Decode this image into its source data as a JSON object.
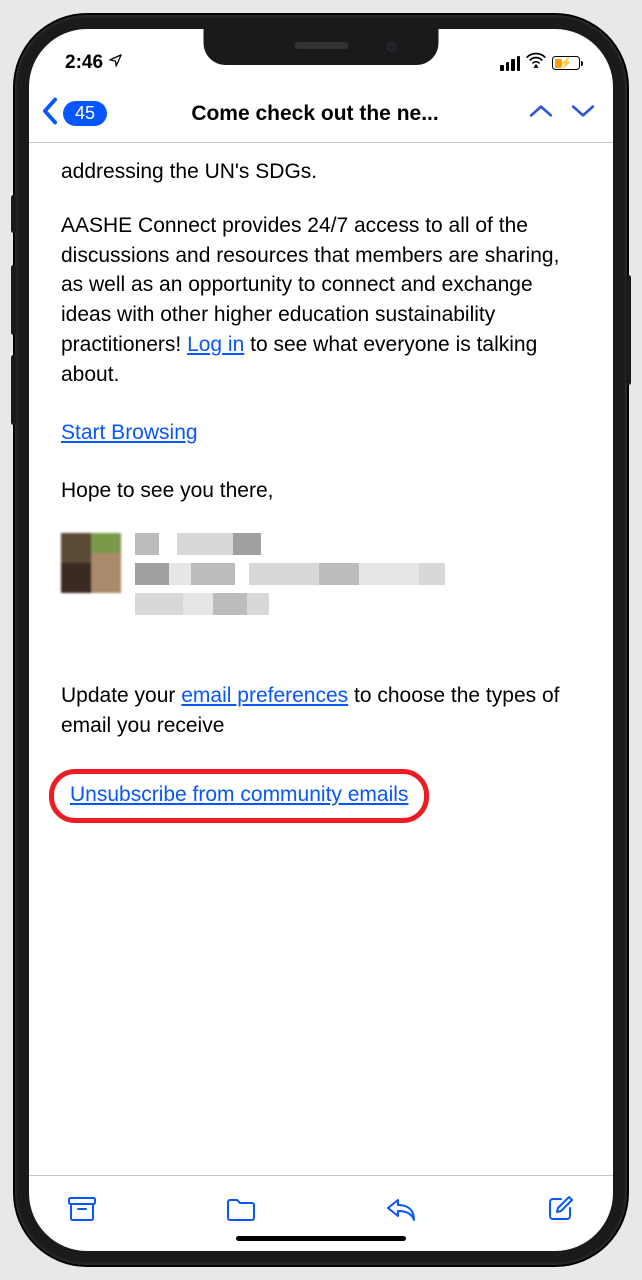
{
  "status": {
    "time": "2:46"
  },
  "nav": {
    "badge": "45",
    "title": "Come check out the ne..."
  },
  "body": {
    "partial_line": "addressing the UN's SDGs.",
    "para1_a": "AASHE Connect provides 24/7 access to all of the discussions and resources that members are sharing, as well as an opportunity to connect and exchange ideas with other higher education sustainability practitioners! ",
    "login_link": "Log in",
    "para1_b": " to see what everyone is talking about.",
    "start_browsing": "Start Browsing",
    "hope": "Hope to see you there,",
    "pref_a": "Update your ",
    "pref_link": "email preferences",
    "pref_b": " to choose the types of email you receive",
    "unsubscribe": "Unsubscribe from community emails"
  }
}
